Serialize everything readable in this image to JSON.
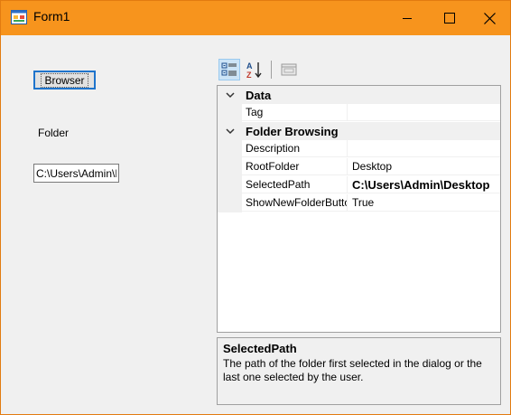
{
  "window": {
    "title": "Form1"
  },
  "form": {
    "browser_button": "Browser",
    "folder_label": "Folder",
    "path_value": "C:\\Users\\Admin\\Desktop"
  },
  "toolbar": {
    "categorized_icon": "categorized-icon",
    "alphabetical_icon": "alphabetical-icon",
    "property_pages_icon": "property-pages-icon"
  },
  "grid": {
    "categories": [
      {
        "name": "Data",
        "properties": [
          {
            "name": "Tag",
            "value": ""
          }
        ]
      },
      {
        "name": "Folder Browsing",
        "properties": [
          {
            "name": "Description",
            "value": ""
          },
          {
            "name": "RootFolder",
            "value": "Desktop"
          },
          {
            "name": "SelectedPath",
            "value": "C:\\Users\\Admin\\Desktop"
          },
          {
            "name": "ShowNewFolderButton",
            "value": "True"
          }
        ]
      }
    ]
  },
  "description": {
    "title": "SelectedPath",
    "text": "The path of the folder first selected in the dialog or the last one selected by the user."
  },
  "colors": {
    "titlebar": "#f7941d",
    "selected_tool": "#cce4f7",
    "window_bg": "#f0f0f0"
  }
}
